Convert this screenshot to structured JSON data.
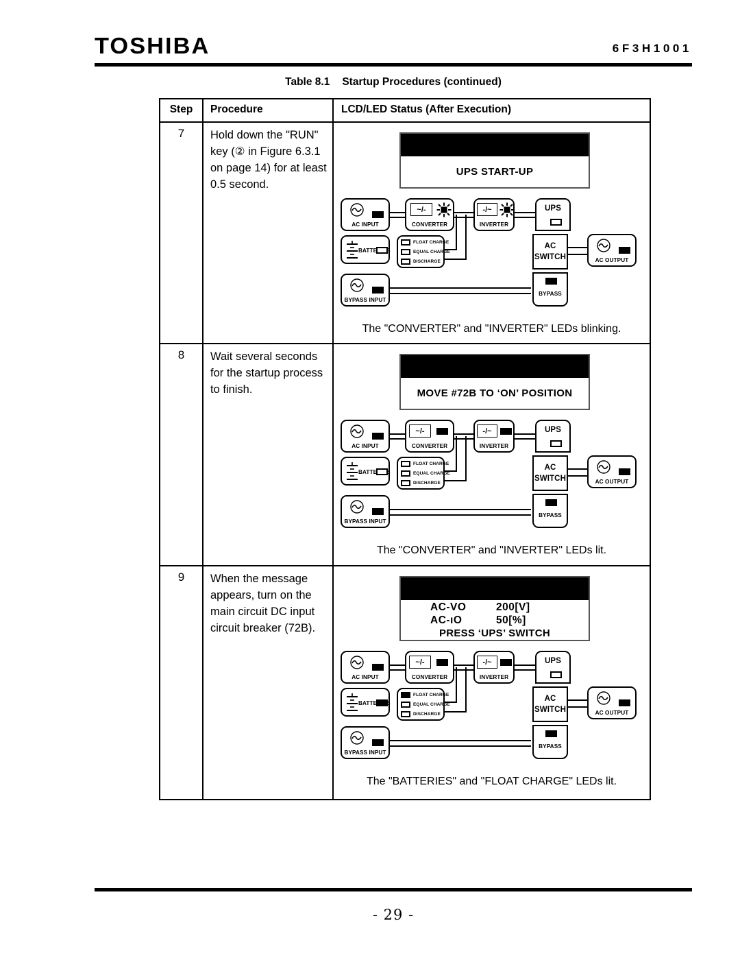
{
  "header": {
    "brand": "TOSHIBA",
    "doc_code": "6F3H1001"
  },
  "table_caption": {
    "number": "Table 8.1",
    "title": "Startup Procedures (continued)"
  },
  "columns": {
    "step": "Step",
    "procedure": "Procedure",
    "status": "LCD/LED Status (After Execution)"
  },
  "rows": [
    {
      "step": "7",
      "procedure": "Hold down the \"RUN\" key (② in Figure 6.3.1 on page 14) for at least 0.5 second.",
      "lcd": {
        "lines": [
          "UPS START-UP"
        ]
      },
      "leds": {
        "ac_input": "on",
        "converter": "blinking",
        "inverter": "blinking",
        "ups": "off",
        "batteries": "off",
        "float_charge": "off",
        "equal_charge": "off",
        "discharge": "off",
        "bypass_input": "on",
        "bypass": "on",
        "ac_output": "on"
      },
      "caption": "The \"CONVERTER\" and \"INVERTER\" LEDs blinking."
    },
    {
      "step": "8",
      "procedure": "Wait several seconds for the startup process to finish.",
      "lcd": {
        "lines": [
          "MOVE #72B TO ‘ON’ POSITION"
        ]
      },
      "leds": {
        "ac_input": "on",
        "converter": "on",
        "inverter": "on",
        "ups": "off",
        "batteries": "off",
        "float_charge": "off",
        "equal_charge": "off",
        "discharge": "off",
        "bypass_input": "on",
        "bypass": "on",
        "ac_output": "on"
      },
      "caption": "The \"CONVERTER\" and \"INVERTER\" LEDs lit."
    },
    {
      "step": "9",
      "procedure": "When the message appears, turn on the main circuit DC input circuit breaker (72B).",
      "lcd": {
        "kv": [
          {
            "key": "AC-VO",
            "value": "200[V]"
          },
          {
            "key": "AC-ıO",
            "value": "50[%]"
          }
        ],
        "lines": [
          "PRESS ‘UPS’ SWITCH"
        ]
      },
      "leds": {
        "ac_input": "on",
        "converter": "on",
        "inverter": "on",
        "ups": "off",
        "batteries": "on",
        "float_charge": "on",
        "equal_charge": "off",
        "discharge": "off",
        "bypass_input": "on",
        "bypass": "on",
        "ac_output": "on"
      },
      "caption": "The \"BATTERIES\" and \"FLOAT CHARGE\" LEDs lit."
    }
  ],
  "diagram_labels": {
    "ac_input": "AC INPUT",
    "converter": "CONVERTER",
    "inverter": "INVERTER",
    "ups": "UPS",
    "batteries": "BATTERIES",
    "float_charge": "FLOAT CHARGE",
    "equal_charge": "EQUAL CHARGE",
    "discharge": "DISCHARGE",
    "ac_switch_1": "AC",
    "ac_switch_2": "SWITCH",
    "ac_output": "AC OUTPUT",
    "bypass_input": "BYPASS INPUT",
    "bypass": "BYPASS",
    "converter_glyph": "~/-",
    "inverter_glyph": "-/~",
    "sine_glyph": "∼"
  },
  "footer": {
    "page_number": "- 29 -"
  }
}
